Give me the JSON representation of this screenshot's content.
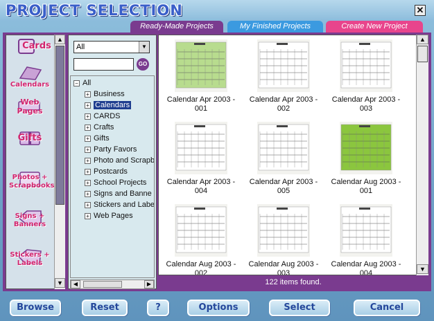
{
  "window": {
    "title": "PROJECT SELECTION",
    "close_glyph": "✕"
  },
  "tabs": [
    {
      "label": "Ready-Made Projects"
    },
    {
      "label": "My Finished Projects"
    },
    {
      "label": "Create New Project"
    }
  ],
  "categories": [
    {
      "label": "Cards",
      "icon": "cards-icon"
    },
    {
      "label": "Calendars",
      "icon": "calendar-icon"
    },
    {
      "label": "Web Pages",
      "icon": "computer-icon"
    },
    {
      "label": "Gifts",
      "icon": "gift-icon"
    },
    {
      "label": "Photos + Scrapbooks",
      "icon": "photo-icon"
    },
    {
      "label": "Signs + Banners",
      "icon": "sign-icon"
    },
    {
      "label": "Stickers + Labels",
      "icon": "sticker-icon"
    }
  ],
  "filter": {
    "selected": "All",
    "search_value": "",
    "go_label": "GO"
  },
  "tree": {
    "root": "All",
    "items": [
      "Business",
      "Calendars",
      "CARDS",
      "Crafts",
      "Gifts",
      "Party Favors",
      "Photo and Scrapb",
      "Postcards",
      "School Projects",
      "Signs and Banne",
      "Stickers and Labe",
      "Web Pages"
    ],
    "selected_index": 1
  },
  "projects": [
    {
      "caption": "Calendar Apr 2003 - 001",
      "accent": "#b8dc8e"
    },
    {
      "caption": "Calendar Apr 2003 - 002",
      "accent": "#ffffff"
    },
    {
      "caption": "Calendar Apr 2003 - 003",
      "accent": "#ffffff"
    },
    {
      "caption": "Calendar Apr 2003 - 004",
      "accent": "#ffffff"
    },
    {
      "caption": "Calendar Apr 2003 - 005",
      "accent": "#ffffff"
    },
    {
      "caption": "Calendar Aug 2003 - 001",
      "accent": "#8bc63e"
    },
    {
      "caption": "Calendar Aug 2003 - 002",
      "accent": "#ffffff"
    },
    {
      "caption": "Calendar Aug 2003 - 003",
      "accent": "#ffffff"
    },
    {
      "caption": "Calendar Aug 2003 - 004",
      "accent": "#ffffff"
    }
  ],
  "status": {
    "text": "122 items found."
  },
  "buttons": {
    "browse": "Browse",
    "reset": "Reset",
    "help": "?",
    "options": "Options",
    "select": "Select",
    "cancel": "Cancel"
  }
}
